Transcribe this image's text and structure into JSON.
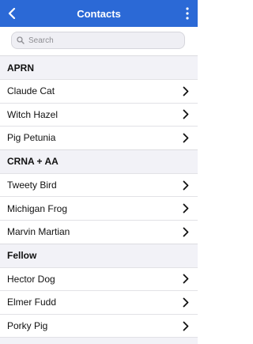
{
  "header": {
    "title": "Contacts"
  },
  "search": {
    "placeholder": "Search"
  },
  "sections": [
    {
      "title": "APRN",
      "items": [
        "Claude Cat",
        "Witch Hazel",
        "Pig Petunia"
      ]
    },
    {
      "title": "CRNA + AA",
      "items": [
        "Tweety Bird",
        "Michigan Frog",
        "Marvin Martian"
      ]
    },
    {
      "title": "Fellow",
      "items": [
        "Hector Dog",
        "Elmer Fudd",
        "Porky Pig"
      ]
    }
  ],
  "colors": {
    "accent": "#2b69d6",
    "section_bg": "#f2f2f7"
  },
  "icons": {
    "back": "chevron-left-icon",
    "more": "more-vertical-icon",
    "search": "search-icon",
    "row": "chevron-right-icon"
  }
}
